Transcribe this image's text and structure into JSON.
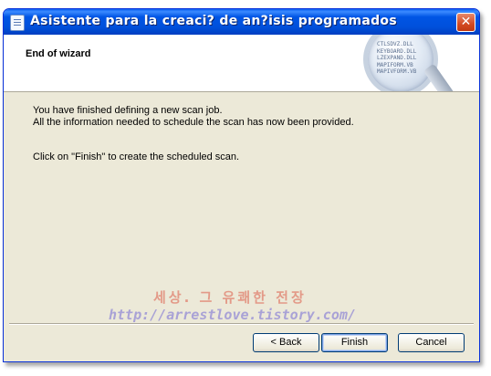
{
  "window": {
    "title": "Asistente para la creaci? de an?isis programados",
    "close_glyph": "✕"
  },
  "header": {
    "title": "End of wizard",
    "illustration_lines": [
      "CTLSDVZ.DLL",
      "KEYBOARD.DLL",
      "LZEXPAND.DLL",
      "MAPIFORM.VB",
      "MAPIVFORM.VB"
    ]
  },
  "content": {
    "line1": "You have finished defining a new scan job.",
    "line2": "All the information needed to schedule the scan has now been provided.",
    "line3": "Click on \"Finish\" to create the scheduled scan."
  },
  "watermark": {
    "line1": "세상. 그 유쾌한 전장",
    "line2": "http://arrestlove.tistory.com/"
  },
  "buttons": {
    "back": "< Back",
    "finish": "Finish",
    "cancel": "Cancel"
  }
}
